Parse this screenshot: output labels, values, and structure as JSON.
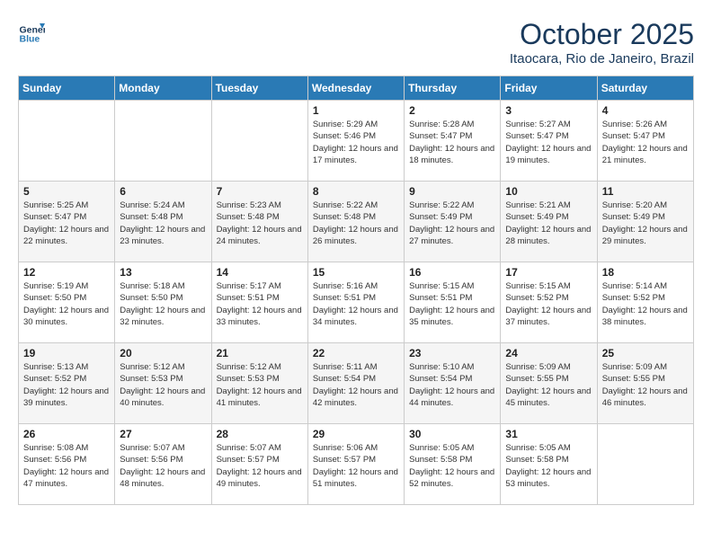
{
  "header": {
    "logo_line1": "General",
    "logo_line2": "Blue",
    "title": "October 2025",
    "subtitle": "Itaocara, Rio de Janeiro, Brazil"
  },
  "days_of_week": [
    "Sunday",
    "Monday",
    "Tuesday",
    "Wednesday",
    "Thursday",
    "Friday",
    "Saturday"
  ],
  "weeks": [
    [
      {
        "day": "",
        "info": ""
      },
      {
        "day": "",
        "info": ""
      },
      {
        "day": "",
        "info": ""
      },
      {
        "day": "1",
        "info": "Sunrise: 5:29 AM\nSunset: 5:46 PM\nDaylight: 12 hours and 17 minutes."
      },
      {
        "day": "2",
        "info": "Sunrise: 5:28 AM\nSunset: 5:47 PM\nDaylight: 12 hours and 18 minutes."
      },
      {
        "day": "3",
        "info": "Sunrise: 5:27 AM\nSunset: 5:47 PM\nDaylight: 12 hours and 19 minutes."
      },
      {
        "day": "4",
        "info": "Sunrise: 5:26 AM\nSunset: 5:47 PM\nDaylight: 12 hours and 21 minutes."
      }
    ],
    [
      {
        "day": "5",
        "info": "Sunrise: 5:25 AM\nSunset: 5:47 PM\nDaylight: 12 hours and 22 minutes."
      },
      {
        "day": "6",
        "info": "Sunrise: 5:24 AM\nSunset: 5:48 PM\nDaylight: 12 hours and 23 minutes."
      },
      {
        "day": "7",
        "info": "Sunrise: 5:23 AM\nSunset: 5:48 PM\nDaylight: 12 hours and 24 minutes."
      },
      {
        "day": "8",
        "info": "Sunrise: 5:22 AM\nSunset: 5:48 PM\nDaylight: 12 hours and 26 minutes."
      },
      {
        "day": "9",
        "info": "Sunrise: 5:22 AM\nSunset: 5:49 PM\nDaylight: 12 hours and 27 minutes."
      },
      {
        "day": "10",
        "info": "Sunrise: 5:21 AM\nSunset: 5:49 PM\nDaylight: 12 hours and 28 minutes."
      },
      {
        "day": "11",
        "info": "Sunrise: 5:20 AM\nSunset: 5:49 PM\nDaylight: 12 hours and 29 minutes."
      }
    ],
    [
      {
        "day": "12",
        "info": "Sunrise: 5:19 AM\nSunset: 5:50 PM\nDaylight: 12 hours and 30 minutes."
      },
      {
        "day": "13",
        "info": "Sunrise: 5:18 AM\nSunset: 5:50 PM\nDaylight: 12 hours and 32 minutes."
      },
      {
        "day": "14",
        "info": "Sunrise: 5:17 AM\nSunset: 5:51 PM\nDaylight: 12 hours and 33 minutes."
      },
      {
        "day": "15",
        "info": "Sunrise: 5:16 AM\nSunset: 5:51 PM\nDaylight: 12 hours and 34 minutes."
      },
      {
        "day": "16",
        "info": "Sunrise: 5:15 AM\nSunset: 5:51 PM\nDaylight: 12 hours and 35 minutes."
      },
      {
        "day": "17",
        "info": "Sunrise: 5:15 AM\nSunset: 5:52 PM\nDaylight: 12 hours and 37 minutes."
      },
      {
        "day": "18",
        "info": "Sunrise: 5:14 AM\nSunset: 5:52 PM\nDaylight: 12 hours and 38 minutes."
      }
    ],
    [
      {
        "day": "19",
        "info": "Sunrise: 5:13 AM\nSunset: 5:52 PM\nDaylight: 12 hours and 39 minutes."
      },
      {
        "day": "20",
        "info": "Sunrise: 5:12 AM\nSunset: 5:53 PM\nDaylight: 12 hours and 40 minutes."
      },
      {
        "day": "21",
        "info": "Sunrise: 5:12 AM\nSunset: 5:53 PM\nDaylight: 12 hours and 41 minutes."
      },
      {
        "day": "22",
        "info": "Sunrise: 5:11 AM\nSunset: 5:54 PM\nDaylight: 12 hours and 42 minutes."
      },
      {
        "day": "23",
        "info": "Sunrise: 5:10 AM\nSunset: 5:54 PM\nDaylight: 12 hours and 44 minutes."
      },
      {
        "day": "24",
        "info": "Sunrise: 5:09 AM\nSunset: 5:55 PM\nDaylight: 12 hours and 45 minutes."
      },
      {
        "day": "25",
        "info": "Sunrise: 5:09 AM\nSunset: 5:55 PM\nDaylight: 12 hours and 46 minutes."
      }
    ],
    [
      {
        "day": "26",
        "info": "Sunrise: 5:08 AM\nSunset: 5:56 PM\nDaylight: 12 hours and 47 minutes."
      },
      {
        "day": "27",
        "info": "Sunrise: 5:07 AM\nSunset: 5:56 PM\nDaylight: 12 hours and 48 minutes."
      },
      {
        "day": "28",
        "info": "Sunrise: 5:07 AM\nSunset: 5:57 PM\nDaylight: 12 hours and 49 minutes."
      },
      {
        "day": "29",
        "info": "Sunrise: 5:06 AM\nSunset: 5:57 PM\nDaylight: 12 hours and 51 minutes."
      },
      {
        "day": "30",
        "info": "Sunrise: 5:05 AM\nSunset: 5:58 PM\nDaylight: 12 hours and 52 minutes."
      },
      {
        "day": "31",
        "info": "Sunrise: 5:05 AM\nSunset: 5:58 PM\nDaylight: 12 hours and 53 minutes."
      },
      {
        "day": "",
        "info": ""
      }
    ]
  ]
}
